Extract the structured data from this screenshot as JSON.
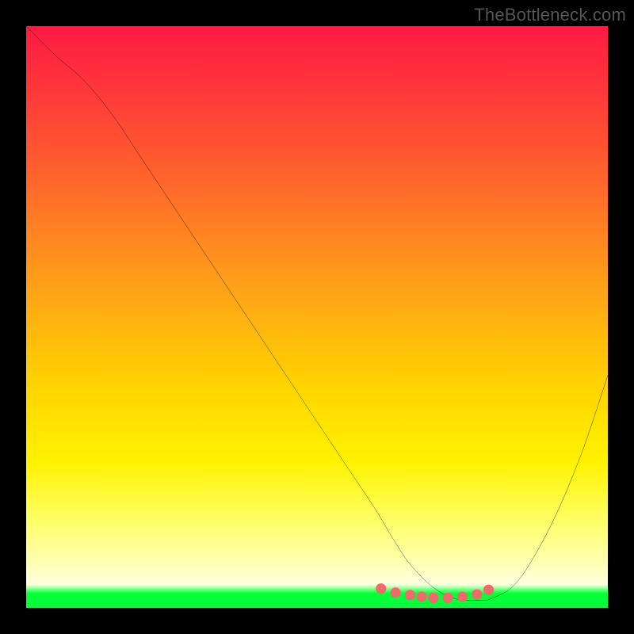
{
  "watermark": "TheBottleneck.com",
  "chart_data": {
    "type": "line",
    "title": "",
    "xlabel": "",
    "ylabel": "",
    "xlim": [
      0,
      100
    ],
    "ylim": [
      0,
      100
    ],
    "grid": false,
    "legend": false,
    "series": [
      {
        "name": "curve",
        "color": "#000000",
        "x": [
          0,
          5,
          10,
          15,
          20,
          25,
          30,
          35,
          40,
          45,
          50,
          55,
          60,
          63,
          66,
          70,
          74,
          78,
          80,
          84,
          88,
          92,
          96,
          100
        ],
        "y": [
          100,
          95,
          90.6,
          84.5,
          77,
          69.5,
          62,
          54.5,
          47,
          39.5,
          32,
          24.5,
          17,
          12,
          7.5,
          3.5,
          1.5,
          1.3,
          1.6,
          4,
          10,
          18,
          28,
          40
        ]
      },
      {
        "name": "highlight-dots",
        "color": "#ef6a6a",
        "type": "scatter",
        "x": [
          61,
          63.5,
          66,
          68,
          70,
          72.5,
          75,
          77.5,
          79.5
        ],
        "y": [
          3.3,
          2.6,
          2.2,
          1.9,
          1.7,
          1.7,
          1.9,
          2.3,
          3.1
        ]
      }
    ],
    "background_gradient": {
      "stops": [
        {
          "pos": 0.0,
          "color": "#ff1a42"
        },
        {
          "pos": 0.12,
          "color": "#ff3a3a"
        },
        {
          "pos": 0.28,
          "color": "#ff6a2a"
        },
        {
          "pos": 0.45,
          "color": "#ffa218"
        },
        {
          "pos": 0.62,
          "color": "#ffd400"
        },
        {
          "pos": 0.75,
          "color": "#fff200"
        },
        {
          "pos": 0.85,
          "color": "#ffff66"
        },
        {
          "pos": 0.92,
          "color": "#ffffb0"
        },
        {
          "pos": 0.96,
          "color": "#ffffe0"
        },
        {
          "pos": 0.975,
          "color": "#06ff3a"
        },
        {
          "pos": 1.0,
          "color": "#06ff3a"
        }
      ]
    }
  }
}
